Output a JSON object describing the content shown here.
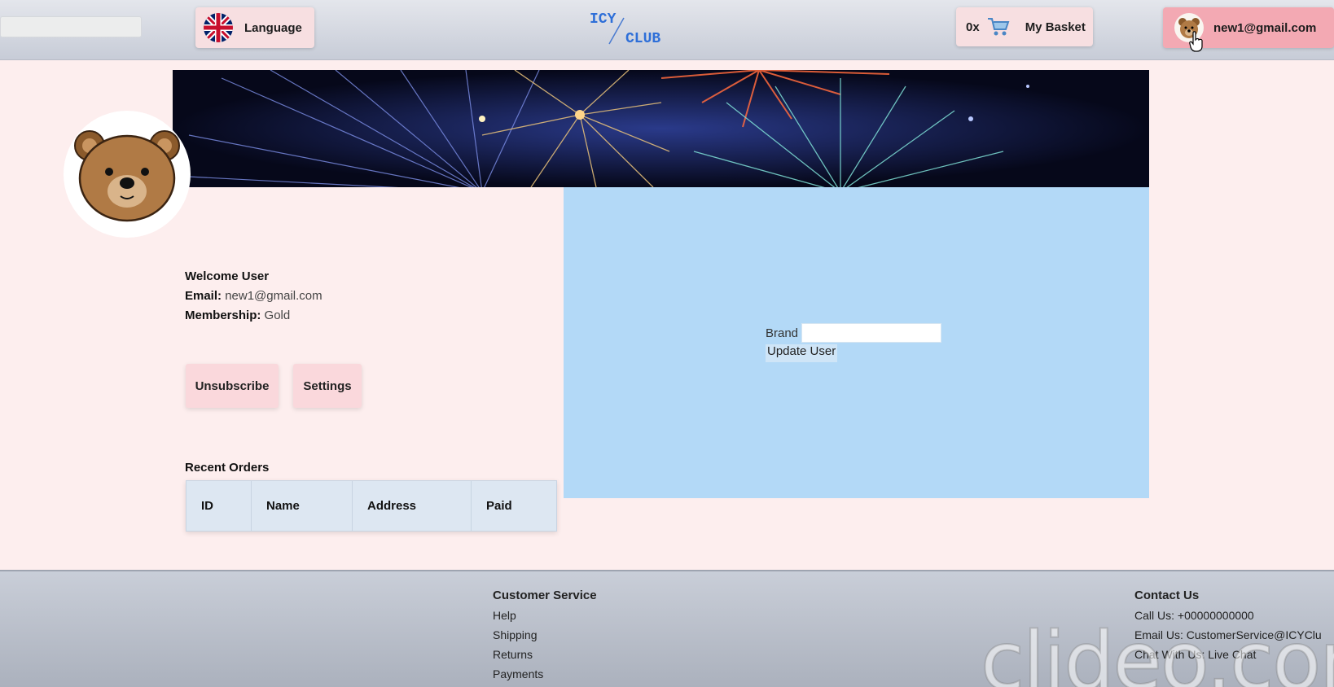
{
  "header": {
    "language_label": "Language",
    "logo_top": "ICY",
    "logo_bottom": "CLUB",
    "basket_count": "0x",
    "basket_label": "My Basket",
    "user_email": "new1@gmail.com"
  },
  "profile": {
    "welcome": "Welcome User",
    "email_label": "Email:",
    "email_value": "new1@gmail.com",
    "membership_label": "Membership:",
    "membership_value": "Gold",
    "unsubscribe_label": "Unsubscribe",
    "settings_label": "Settings"
  },
  "orders": {
    "title": "Recent Orders",
    "columns": [
      "ID",
      "Name",
      "Address",
      "Paid"
    ]
  },
  "panel": {
    "brand_label": "Brand",
    "brand_value": "",
    "update_label": "Update User"
  },
  "footer": {
    "customer_service": {
      "title": "Customer Service",
      "links": [
        "Help",
        "Shipping",
        "Returns",
        "Payments"
      ]
    },
    "contact": {
      "title": "Contact Us",
      "lines": [
        "Call Us: +00000000000",
        "Email Us: CustomerService@ICYClu",
        "Chat With Us: Live Chat"
      ]
    }
  },
  "watermark": "clideo.com",
  "colors": {
    "page_bg": "#fdeeee",
    "accent_pink": "#f3a9b3",
    "panel_blue": "#b3d9f7",
    "logo_blue": "#2e6fd8"
  },
  "icons": [
    "uk-flag-icon",
    "cart-icon",
    "bear-avatar-icon",
    "cursor-hand-icon"
  ]
}
